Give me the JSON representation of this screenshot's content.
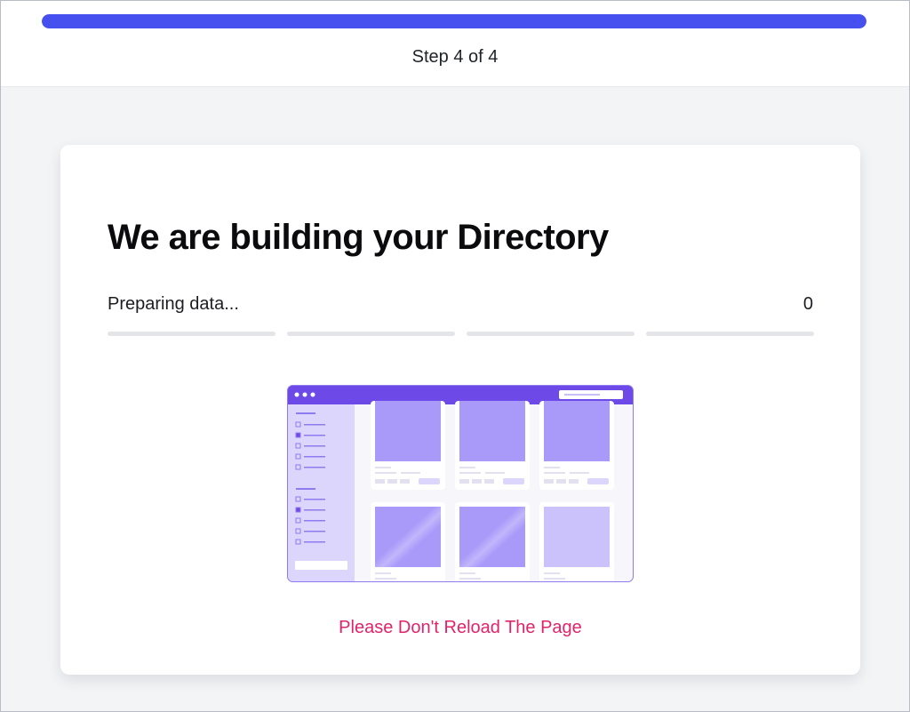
{
  "wizard": {
    "step_label": "Step 4 of 4",
    "progress_fraction": 1.0,
    "progress_color": "#4650ee"
  },
  "build": {
    "title": "We are building your Directory",
    "status": "Preparing data...",
    "count": "0",
    "segments_total": 4,
    "segments_done": 0,
    "warning": "Please Don't Reload The Page",
    "warning_color": "#e0246a"
  },
  "illustration": {
    "name": "directory-preview-illustration",
    "accent_color": "#6d4ae8"
  }
}
